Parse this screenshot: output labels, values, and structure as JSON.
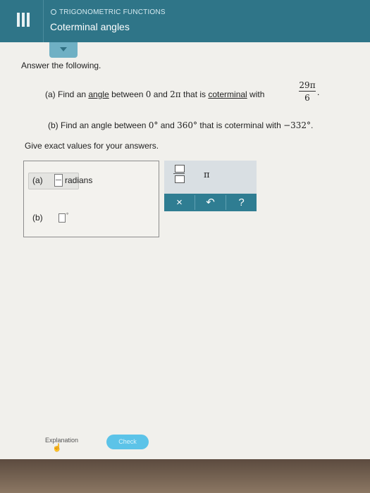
{
  "header": {
    "topic": "TRIGONOMETRIC FUNCTIONS",
    "title": "Coterminal angles"
  },
  "main": {
    "prompt": "Answer the following.",
    "part_a": {
      "label": "(a)",
      "text_1": "Find an ",
      "link_angle": "angle",
      "text_2": " between ",
      "zero": "0",
      "text_and": " and ",
      "two_pi": "2π",
      "text_3": " that is ",
      "link_coterminal": "coterminal",
      "text_4": " with",
      "fraction_numerator": "29π",
      "fraction_denominator": "6",
      "end": "."
    },
    "part_b": {
      "label": "(b)",
      "text": "Find an angle between ",
      "from": "0°",
      "and": " and ",
      "to": "360°",
      "text_2": " that is coterminal with ",
      "value": "−332°",
      "end": "."
    },
    "note": "Give exact values for your answers."
  },
  "answer": {
    "a_label": "(a)",
    "a_unit": "radians",
    "b_label": "(b)",
    "b_unit": "°"
  },
  "keypad": {
    "fraction_icon": "fraction-icon",
    "pi": "π",
    "clear": "×",
    "undo": "↶",
    "help": "?"
  },
  "footer": {
    "explanation": "Explanation",
    "check": "Check"
  },
  "colors": {
    "header": "#2f7588",
    "keypad_bar": "#2f7d92",
    "check_button": "#5cc3e8"
  }
}
